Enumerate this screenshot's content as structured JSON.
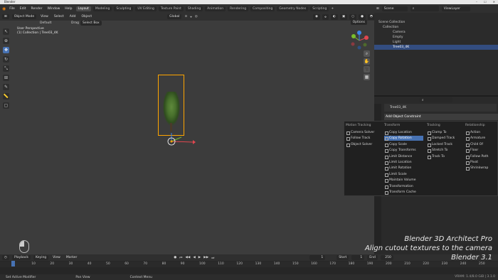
{
  "window": {
    "title": "Blender",
    "controls": [
      "–",
      "☐",
      "✕"
    ]
  },
  "menubar": {
    "items": [
      "File",
      "Edit",
      "Render",
      "Window",
      "Help"
    ]
  },
  "workspaces": [
    "Layout",
    "Modeling",
    "Sculpting",
    "UV Editing",
    "Texture Paint",
    "Shading",
    "Animation",
    "Rendering",
    "Compositing",
    "Geometry Nodes",
    "Scripting"
  ],
  "active_workspace": "Layout",
  "scene": {
    "label": "Scene",
    "viewlayer": "ViewLayer"
  },
  "viewport": {
    "mode": "Object Mode",
    "menus": [
      "View",
      "Select",
      "Add",
      "Object"
    ],
    "orientation": "Global",
    "orientation_label": "Default",
    "drag_label": "Drag",
    "drag_value": "Select Box",
    "options": "Options",
    "info_line1": "User Perspective",
    "info_line2": "(1) Collection | Tree03_4K"
  },
  "outliner": {
    "title": "Scene Collection",
    "rows": [
      {
        "label": "Collection"
      },
      {
        "label": "Camera"
      },
      {
        "label": "Empty"
      },
      {
        "label": "Light"
      },
      {
        "label": "Tree03_4K"
      }
    ]
  },
  "properties": {
    "object": "Tree03_4K"
  },
  "menu": {
    "title": "Add Object Constraint",
    "columns": [
      {
        "header": "Motion Tracking",
        "items": [
          "Camera Solver",
          "Follow Track",
          "Object Solver"
        ]
      },
      {
        "header": "Transform",
        "items": [
          "Copy Location",
          "Copy Rotation",
          "Copy Scale",
          "Copy Transforms",
          "Limit Distance",
          "Limit Location",
          "Limit Rotation",
          "Limit Scale",
          "Maintain Volume",
          "Transformation",
          "Transform Cache"
        ]
      },
      {
        "header": "Tracking",
        "items": [
          "Clamp To",
          "Damped Track",
          "Locked Track",
          "Stretch To",
          "Track To"
        ]
      },
      {
        "header": "Relationship",
        "items": [
          "Action",
          "Armature",
          "Child Of",
          "Floor",
          "Follow Path",
          "Pivot",
          "Shrinkwrap"
        ]
      }
    ],
    "highlighted": "Copy Rotation"
  },
  "timeline": {
    "menus": [
      "Playback",
      "Keying",
      "View",
      "Marker"
    ],
    "current_frame": "1",
    "start_label": "Start",
    "start": "1",
    "end_label": "End",
    "end": "250",
    "ticks": [
      "0",
      "10",
      "20",
      "30",
      "40",
      "50",
      "60",
      "70",
      "80",
      "90",
      "100",
      "110",
      "120",
      "130",
      "140",
      "150",
      "160",
      "170",
      "180",
      "190",
      "200",
      "210",
      "220",
      "230",
      "240",
      "250"
    ]
  },
  "status": {
    "items": [
      "Set Active Modifier",
      "Pan View",
      "Context Menu"
    ],
    "vram": "VRAM: 1.4/8.0 GiB | 3.1.0"
  },
  "overlay": {
    "line1": "Blender 3D Architect Pro",
    "line2": "Align cutout textures to the camera",
    "line3": "Blender 3.1"
  }
}
